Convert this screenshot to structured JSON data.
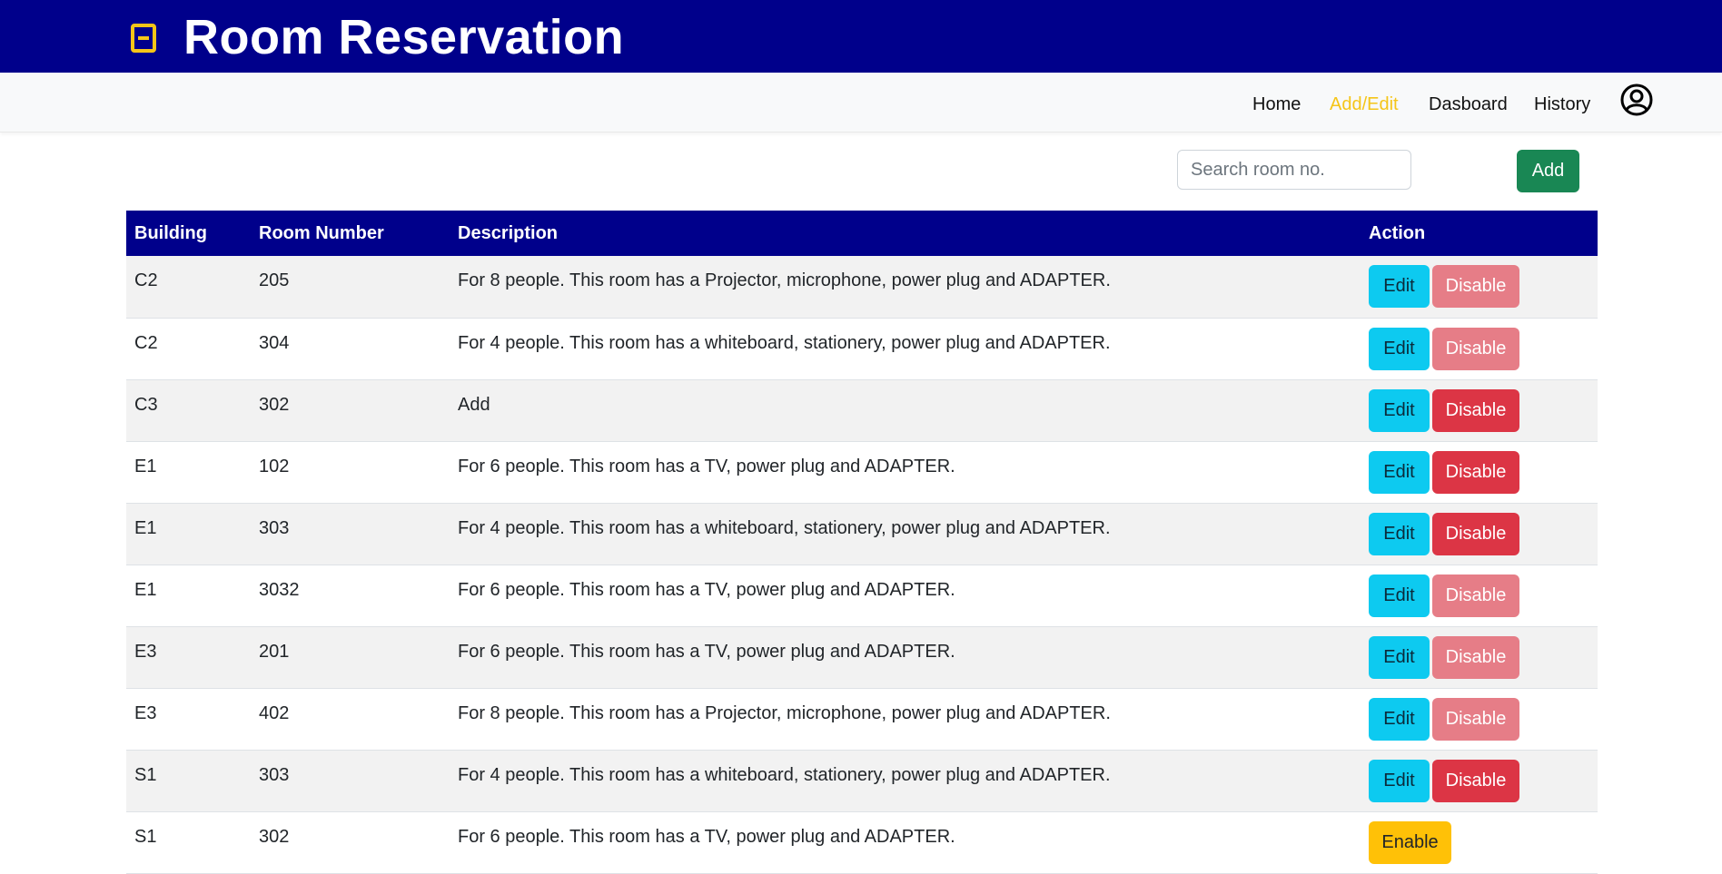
{
  "header": {
    "title": "Room Reservation",
    "icon": "book-icon"
  },
  "nav": {
    "items": [
      {
        "label": "Home"
      },
      {
        "label": "Add/Edit"
      },
      {
        "label": "Dasboard"
      },
      {
        "label": "History"
      }
    ],
    "active": "Add/Edit",
    "user_icon": "user-circle-icon"
  },
  "toolbar": {
    "search_placeholder": "Search room no.",
    "add_label": "Add"
  },
  "table": {
    "headers": {
      "building": "Building",
      "room": "Room Number",
      "description": "Description",
      "action": "Action"
    },
    "rows": [
      {
        "building": "C2",
        "room": "205",
        "description": "For 8 people. This room has a Projector, microphone, power plug and ADAPTER.",
        "edit": "Edit",
        "toggle": "Disable",
        "toggle_state": "disabled-style"
      },
      {
        "building": "C2",
        "room": "304",
        "description": "For 4 people. This room has a whiteboard, stationery, power plug and ADAPTER.",
        "edit": "Edit",
        "toggle": "Disable",
        "toggle_state": "disabled-style"
      },
      {
        "building": "C3",
        "room": "302",
        "description": "Add",
        "edit": "Edit",
        "toggle": "Disable",
        "toggle_state": "active"
      },
      {
        "building": "E1",
        "room": "102",
        "description": "For 6 people. This room has a TV, power plug and ADAPTER.",
        "edit": "Edit",
        "toggle": "Disable",
        "toggle_state": "active"
      },
      {
        "building": "E1",
        "room": "303",
        "description": "For 4 people. This room has a whiteboard, stationery, power plug and ADAPTER.",
        "edit": "Edit",
        "toggle": "Disable",
        "toggle_state": "active"
      },
      {
        "building": "E1",
        "room": "3032",
        "description": "For 6 people. This room has a TV, power plug and ADAPTER.",
        "edit": "Edit",
        "toggle": "Disable",
        "toggle_state": "disabled-style"
      },
      {
        "building": "E3",
        "room": "201",
        "description": "For 6 people. This room has a TV, power plug and ADAPTER.",
        "edit": "Edit",
        "toggle": "Disable",
        "toggle_state": "disabled-style"
      },
      {
        "building": "E3",
        "room": "402",
        "description": "For 8 people. This room has a Projector, microphone, power plug and ADAPTER.",
        "edit": "Edit",
        "toggle": "Disable",
        "toggle_state": "disabled-style"
      },
      {
        "building": "S1",
        "room": "303",
        "description": "For 4 people. This room has a whiteboard, stationery, power plug and ADAPTER.",
        "edit": "Edit",
        "toggle": "Disable",
        "toggle_state": "active"
      },
      {
        "building": "S1",
        "room": "302",
        "description": "For 6 people. This room has a TV, power plug and ADAPTER.",
        "toggle": "Enable",
        "toggle_state": "enable"
      }
    ]
  },
  "colors": {
    "primary": "#00008b",
    "accent": "#f5c518",
    "edit": "#0dcaf0",
    "disable": "#dc3545",
    "disable_faded": "#e67d87",
    "enable": "#ffc107",
    "add": "#198754"
  }
}
